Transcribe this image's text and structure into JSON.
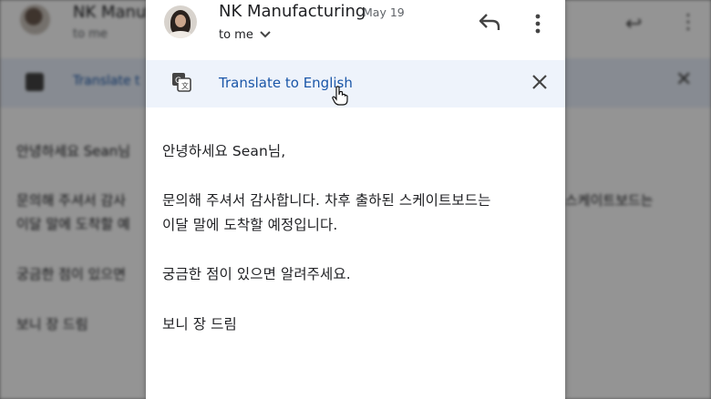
{
  "email": {
    "sender": "NK Manufacturing",
    "date": "May 19",
    "recipient": "to me"
  },
  "translate": {
    "link_label": "Translate to English"
  },
  "body": {
    "greeting": "안녕하세요 Sean님,",
    "line1": "문의해 주셔서 감사합니다. 차후 출하된 스케이트보드는",
    "line2": "이달 말에 도착할 예정입니다.",
    "line3": "궁금한 점이 있으면 알려주세요.",
    "signoff": "보니 장 드림"
  },
  "background": {
    "sender_fragment": "NK Manufa",
    "translate_fragment": "Translate t",
    "greeting_fragment": "안녕하세요 Sean님",
    "line1_fragment": "문의해 주셔서 감사",
    "line2_fragment": "이달 말에 도착할 예",
    "line3_fragment": "궁금한 점이 있으면",
    "line1_right_fragment": "스케이트보드는"
  },
  "icons": {
    "reply": "reply-icon",
    "more": "more-vertical-icon",
    "translate": "google-translate-icon",
    "close": "close-icon",
    "expand": "chevron-down-icon",
    "cursor": "hand-pointer-icon"
  },
  "colors": {
    "link": "#1a56a8",
    "translate_bar": "#eef3fb",
    "text": "#202124",
    "muted": "#5f6368"
  }
}
